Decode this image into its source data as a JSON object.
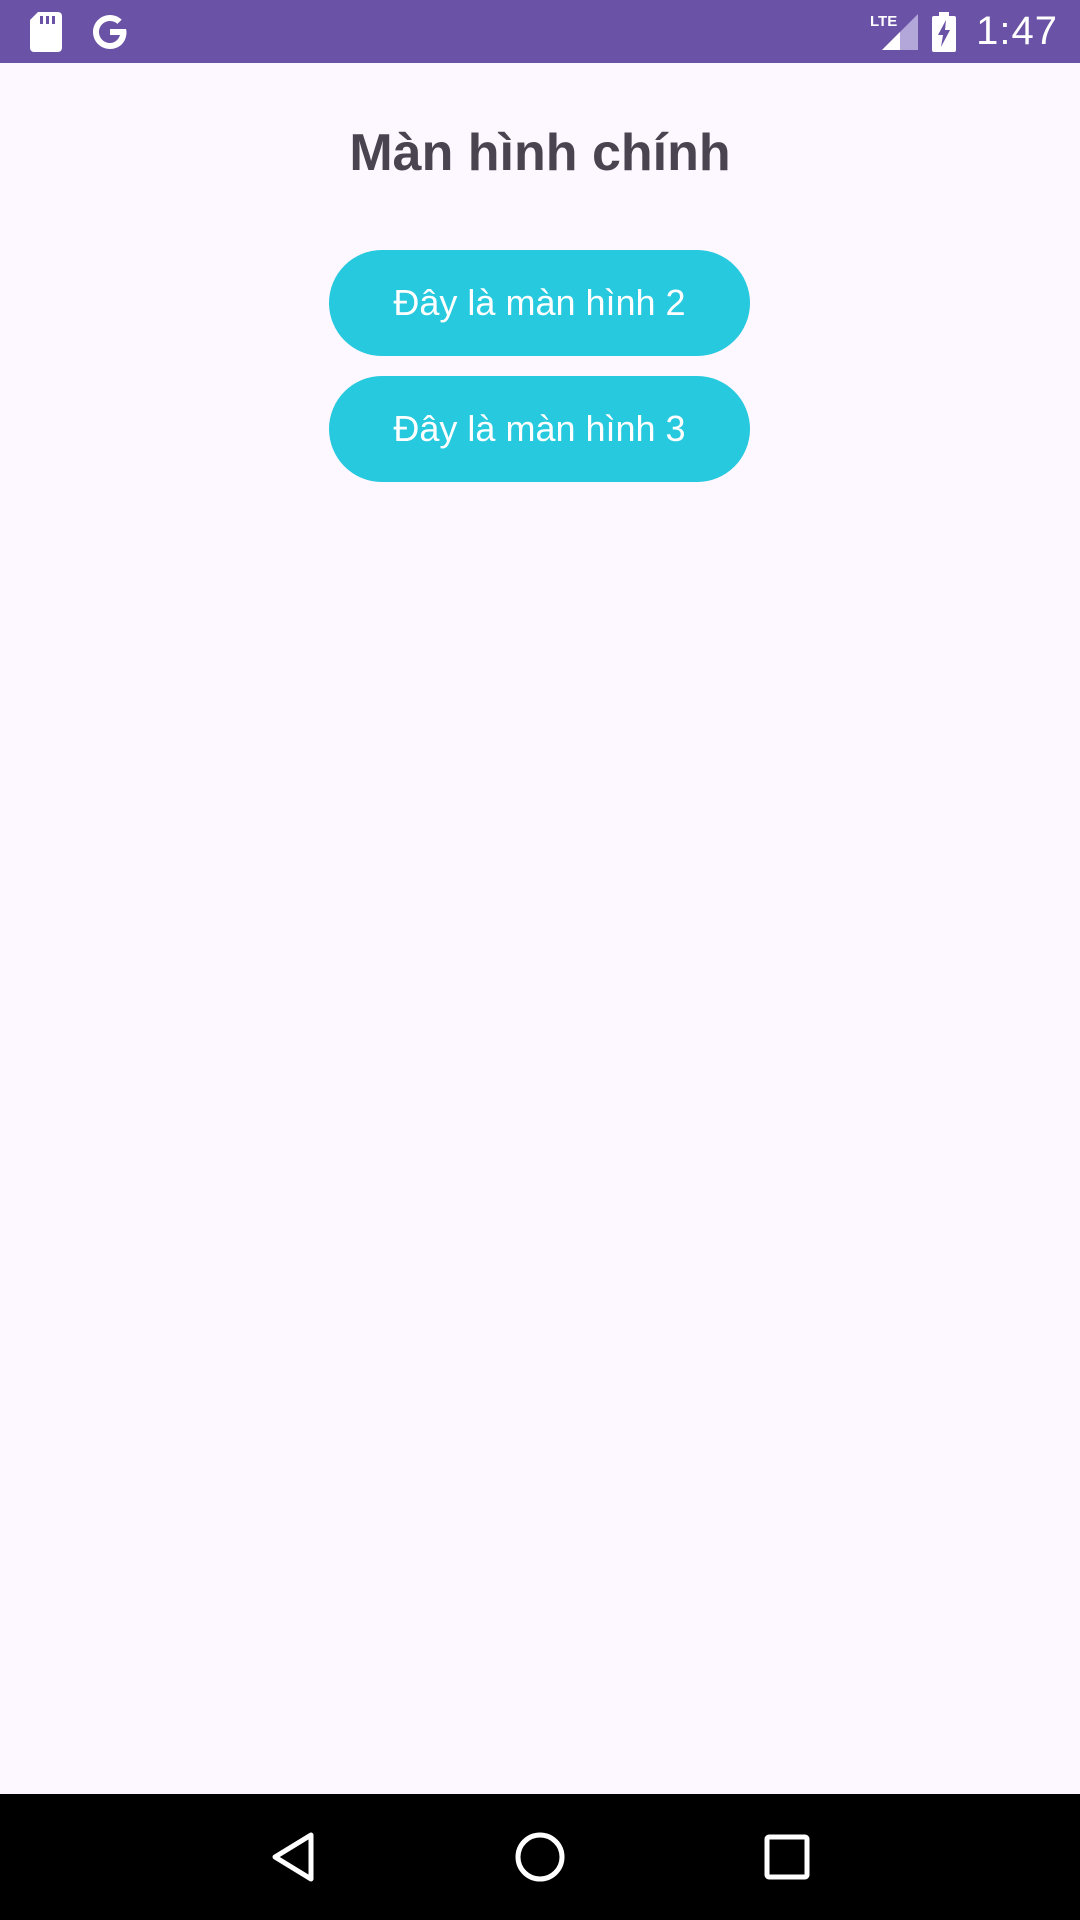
{
  "status_bar": {
    "icons_left": [
      "sd-card-icon",
      "google-icon"
    ],
    "network": "LTE",
    "icons_right": [
      "lte-signal-icon",
      "battery-charging-icon"
    ],
    "time": "1:47",
    "color": "#6a52a6"
  },
  "main": {
    "title": "Màn hình chính",
    "buttons": [
      {
        "label": "Đây là màn hình 2"
      },
      {
        "label": "Đây là màn hình 3"
      }
    ],
    "button_color": "#26c9de",
    "background": "#fdf7ff"
  },
  "nav_bar": {
    "keys": [
      "back-icon",
      "home-icon",
      "recents-icon"
    ]
  }
}
